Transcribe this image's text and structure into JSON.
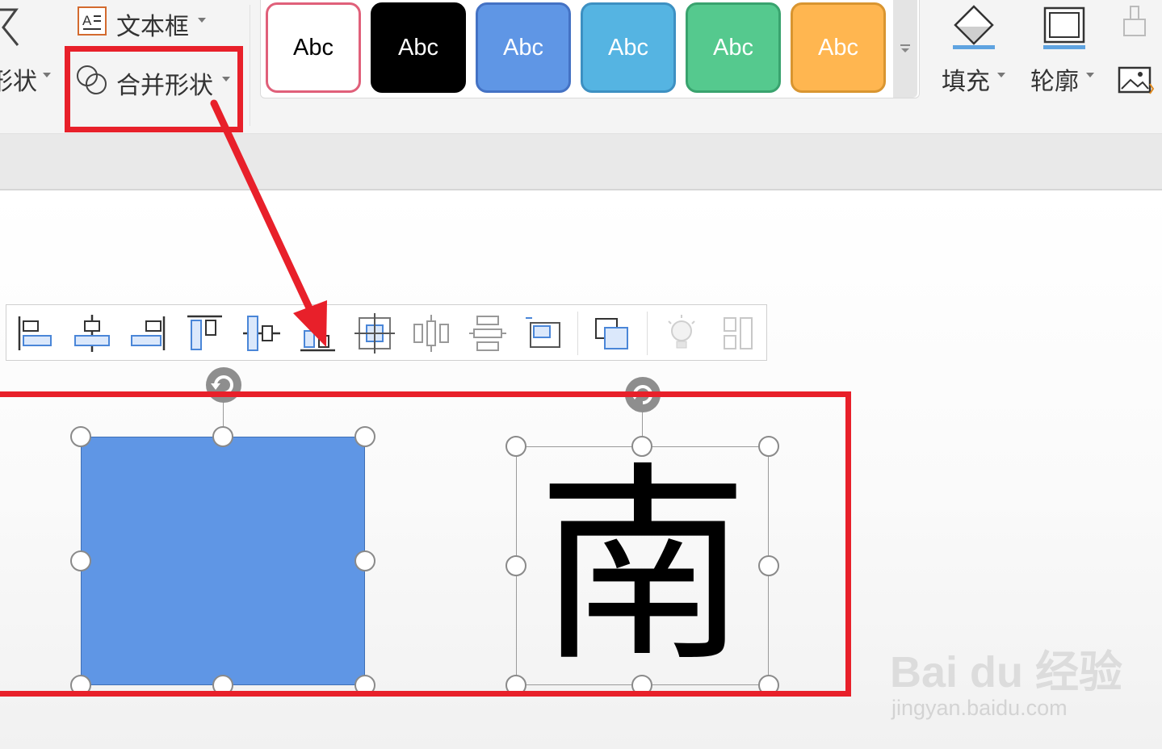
{
  "ribbon": {
    "shapes_label": "形状",
    "textbox_label": "文本框",
    "merge_shapes_label": "合并形状",
    "fill_label": "填充",
    "outline_label": "轮廓"
  },
  "style_gallery": {
    "swatches": [
      {
        "label": "Abc",
        "fill": "#ffffff",
        "border": "#e0607a",
        "text": "#000000"
      },
      {
        "label": "Abc",
        "fill": "#000000",
        "border": "#000000",
        "text": "#ffffff"
      },
      {
        "label": "Abc",
        "fill": "#5f96e5",
        "border": "#4472c4",
        "text": "#ffffff"
      },
      {
        "label": "Abc",
        "fill": "#55b4e2",
        "border": "#3d90c2",
        "text": "#ffffff"
      },
      {
        "label": "Abc",
        "fill": "#55c98e",
        "border": "#39a36e",
        "text": "#ffffff"
      },
      {
        "label": "Abc",
        "fill": "#ffb650",
        "border": "#d99530",
        "text": "#ffffff"
      }
    ]
  },
  "align_toolbar": {
    "buttons": [
      "align-left",
      "align-center",
      "align-right",
      "align-top",
      "align-middle",
      "align-bottom",
      "align-center-both",
      "distribute-horizontal",
      "distribute-vertical",
      "resize-to-fit",
      "group",
      "smart-tip",
      "split-layout"
    ]
  },
  "canvas": {
    "shape_fill": "#5f96e5",
    "text_shape": "南"
  },
  "annotation_color": "#e8202a",
  "watermark": {
    "logo": "Bai du 经验",
    "url": "jingyan.baidu.com"
  }
}
